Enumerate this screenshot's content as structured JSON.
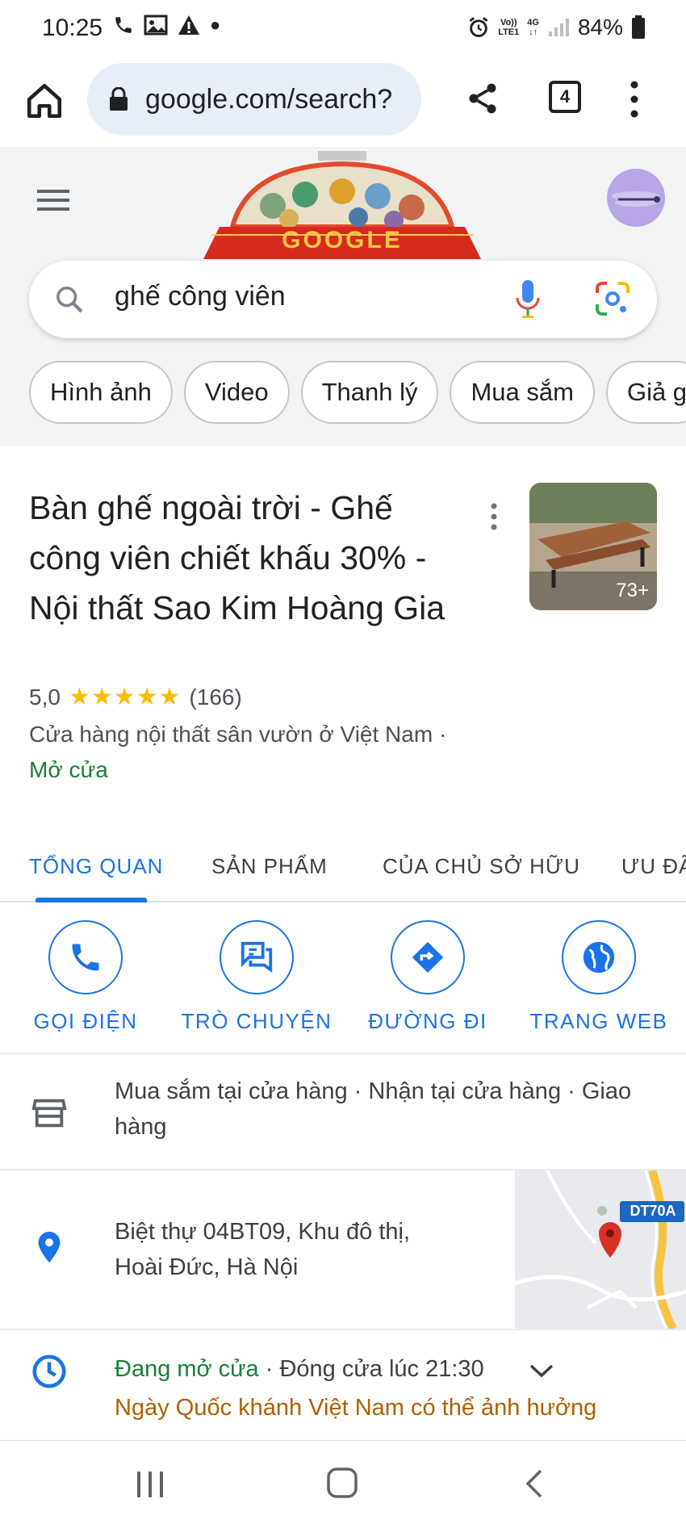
{
  "status_bar": {
    "time": "10:25",
    "volte_label_top": "Vo))",
    "volte_label_bottom": "LTE1",
    "network_label": "4G",
    "battery": "84%"
  },
  "browser": {
    "url": "google.com/search?",
    "tab_count": "4"
  },
  "google": {
    "doodle_text": "GOOGLE",
    "query": "ghế công viên",
    "chips": [
      "Hình ảnh",
      "Video",
      "Thanh lý",
      "Mua sắm",
      "Giả g"
    ]
  },
  "result": {
    "title": "Bàn ghế ngoài trời - Ghế công viên chiết khấu 30% -Nội thất Sao Kim Hoàng Gia",
    "thumb_count": "73+",
    "rating_value": "5,0",
    "stars": "★★★★★",
    "review_count": "(166)",
    "category": "Cửa hàng nội thất sân vườn ở Việt Nam",
    "separator": " · ",
    "open_status": "Mở cửa",
    "tabs": [
      "TỔNG QUAN",
      "SẢN PHẨM",
      "CỦA CHỦ SỞ HỮU",
      "ƯU ĐÃ"
    ],
    "actions": [
      "GỌI ĐIỆN",
      "TRÒ CHUYỆN",
      "ĐƯỜNG ĐI",
      "TRANG WEB"
    ],
    "services": "Mua sắm tại cửa hàng · Nhận tại cửa hàng · Giao hàng",
    "address": "Biệt thự 04BT09, Khu đô thị, Hoài Đức, Hà Nội",
    "map_road_label": "DT70A",
    "hours_open": "Đang mở cửa",
    "hours_sep": " · ",
    "hours_close": "Đóng cửa lúc 21:30",
    "holiday_notice": "Ngày Quốc khánh Việt Nam có thể ảnh hưởng"
  },
  "colors": {
    "accent": "#1a73e8",
    "open_green": "#188038",
    "star": "#fbbc04",
    "notice": "#b06000"
  }
}
